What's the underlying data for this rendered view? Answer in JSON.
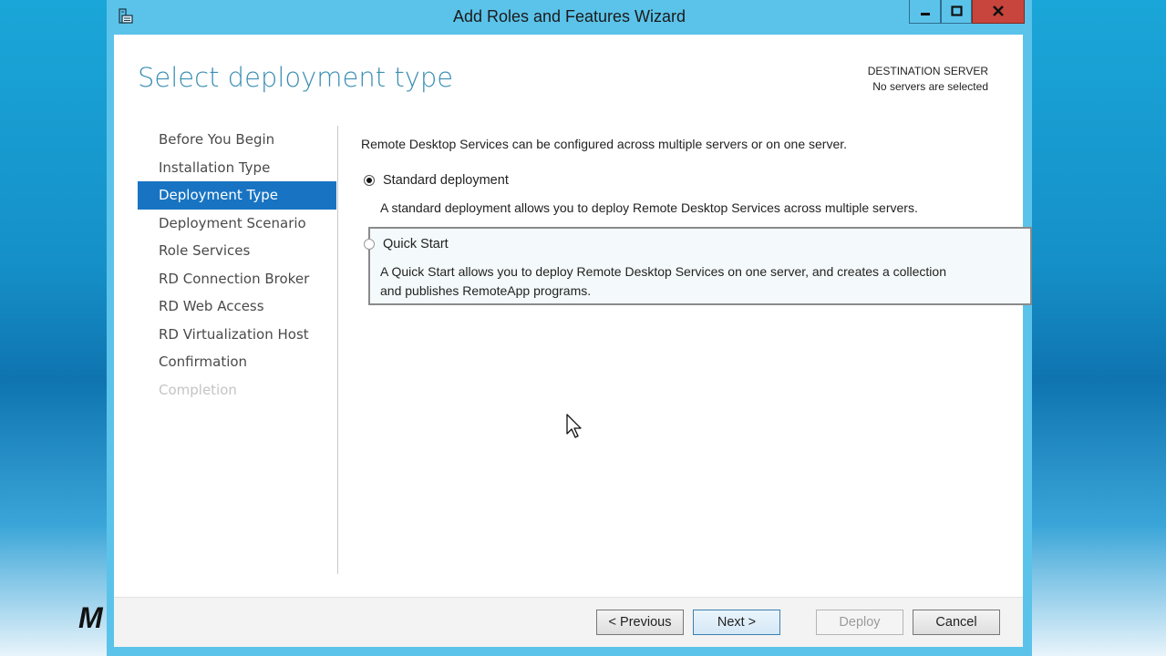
{
  "background": {
    "brand_text": "M"
  },
  "window": {
    "title": "Add Roles and Features Wizard",
    "controls": {
      "minimize": "minimize-icon",
      "maximize": "maximize-icon",
      "close": "close-icon"
    }
  },
  "page": {
    "title": "Select deployment type",
    "destination_label": "DESTINATION SERVER",
    "destination_value": "No servers are selected"
  },
  "nav": {
    "items": [
      {
        "label": "Before You Begin",
        "state": "normal"
      },
      {
        "label": "Installation Type",
        "state": "normal"
      },
      {
        "label": "Deployment Type",
        "state": "active"
      },
      {
        "label": "Deployment Scenario",
        "state": "normal"
      },
      {
        "label": "Role Services",
        "state": "normal"
      },
      {
        "label": "RD Connection Broker",
        "state": "normal"
      },
      {
        "label": "RD Web Access",
        "state": "normal"
      },
      {
        "label": "RD Virtualization Host",
        "state": "normal"
      },
      {
        "label": "Confirmation",
        "state": "normal"
      },
      {
        "label": "Completion",
        "state": "disabled"
      }
    ]
  },
  "main": {
    "intro": "Remote Desktop Services can be configured across multiple servers or on one server.",
    "options": [
      {
        "label": "Standard deployment",
        "checked": true,
        "description": "A standard deployment allows you to deploy Remote Desktop Services across multiple servers."
      },
      {
        "label": "Quick Start",
        "checked": false,
        "description_line1": "A Quick Start allows you to deploy Remote Desktop Services on one server, and creates a collection",
        "description_line2": "and publishes RemoteApp programs."
      }
    ]
  },
  "footer": {
    "previous": "< Previous",
    "next": "Next >",
    "deploy": "Deploy",
    "cancel": "Cancel"
  },
  "colors": {
    "accent": "#1874c3",
    "title_blue": "#3a8eb4",
    "window_frame": "#5bc3ea",
    "close_red": "#c7453c"
  }
}
